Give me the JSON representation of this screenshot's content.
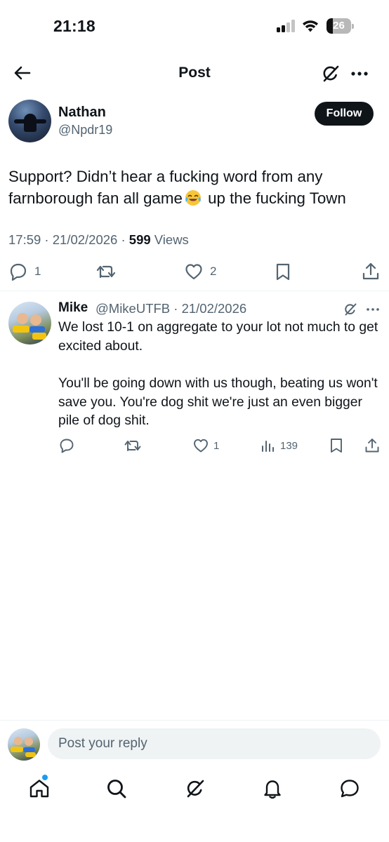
{
  "status_bar": {
    "time": "21:18",
    "battery": "26",
    "battery_level": 0.26
  },
  "header": {
    "title": "Post",
    "back_icon": "arrow-left-icon",
    "grok_icon": "grok-icon",
    "more_icon": "more-horizontal-icon"
  },
  "post": {
    "author_name": "Nathan",
    "author_handle": "@Npdr19",
    "follow_label": "Follow",
    "text_part1": "Support? Didn’t hear a fucking word from any farnborough fan all game",
    "emoji": "face-with-tears-of-joy",
    "text_part2": " up the fucking Town",
    "timestamp": "17:59 · 21/02/2026 · ",
    "views_count": "599",
    "views_label": " Views",
    "reply_count": "1",
    "like_count": "2"
  },
  "reply": {
    "author_name": "Mike",
    "author_handle_date": "@MikeUTFB · 21/02/2026",
    "paragraph1": "We lost 10-1 on aggregate to your lot not much to get excited about.",
    "paragraph2": "You'll be going down with us though, beating us won't save you. You're dog shit we're just an even bigger pile of dog shit.",
    "like_count": "1",
    "views_count": "139"
  },
  "composer": {
    "placeholder": "Post your reply"
  },
  "bottom_nav": {
    "items": [
      "home-icon",
      "search-icon",
      "grok-icon",
      "notifications-icon",
      "messages-icon"
    ],
    "accent": "#1d9bf0"
  },
  "colors": {
    "text": "#0f1419",
    "secondary": "#536471",
    "divider": "#eff3f4"
  }
}
